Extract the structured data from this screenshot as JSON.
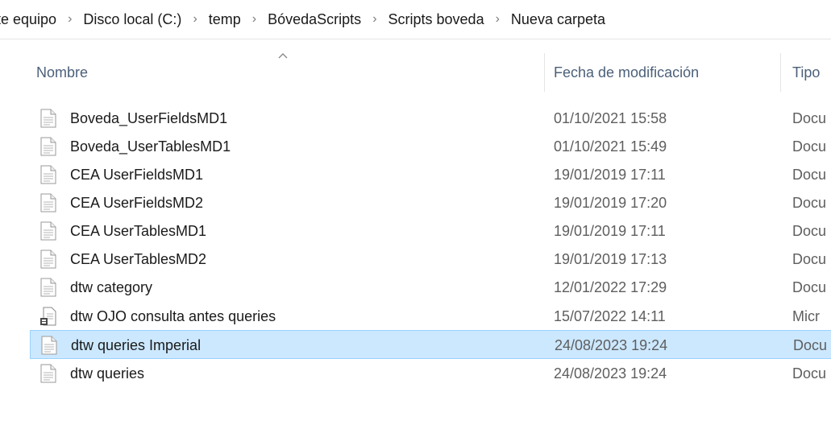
{
  "breadcrumb": [
    "te equipo",
    "Disco local (C:)",
    "temp",
    "BóvedaScripts",
    "Scripts boveda",
    "Nueva carpeta"
  ],
  "columns": {
    "name": "Nombre",
    "date": "Fecha de modificación",
    "type": "Tipo"
  },
  "files": [
    {
      "name": "Boveda_UserFieldsMD1",
      "date": "01/10/2021 15:58",
      "type": "Docu",
      "icon": "text-document-icon"
    },
    {
      "name": "Boveda_UserTablesMD1",
      "date": "01/10/2021 15:49",
      "type": "Docu",
      "icon": "text-document-icon"
    },
    {
      "name": "CEA UserFieldsMD1",
      "date": "19/01/2019 17:11",
      "type": "Docu",
      "icon": "text-document-icon"
    },
    {
      "name": "CEA UserFieldsMD2",
      "date": "19/01/2019 17:20",
      "type": "Docu",
      "icon": "text-document-icon"
    },
    {
      "name": "CEA UserTablesMD1",
      "date": "19/01/2019 17:11",
      "type": "Docu",
      "icon": "text-document-icon"
    },
    {
      "name": "CEA UserTablesMD2",
      "date": "19/01/2019 17:13",
      "type": "Docu",
      "icon": "text-document-icon"
    },
    {
      "name": "dtw category",
      "date": "12/01/2022 17:29",
      "type": "Docu",
      "icon": "text-document-icon"
    },
    {
      "name": "dtw OJO consulta antes queries",
      "date": "15/07/2022 14:11",
      "type": "Micr",
      "icon": "sql-script-icon"
    },
    {
      "name": "dtw queries Imperial",
      "date": "24/08/2023 19:24",
      "type": "Docu",
      "icon": "text-document-icon",
      "selected": true
    },
    {
      "name": "dtw queries",
      "date": "24/08/2023 19:24",
      "type": "Docu",
      "icon": "text-document-icon"
    }
  ],
  "colors": {
    "selection_background": "#cce8ff",
    "selection_border": "#99d1ff",
    "header_text": "#4c607a"
  }
}
